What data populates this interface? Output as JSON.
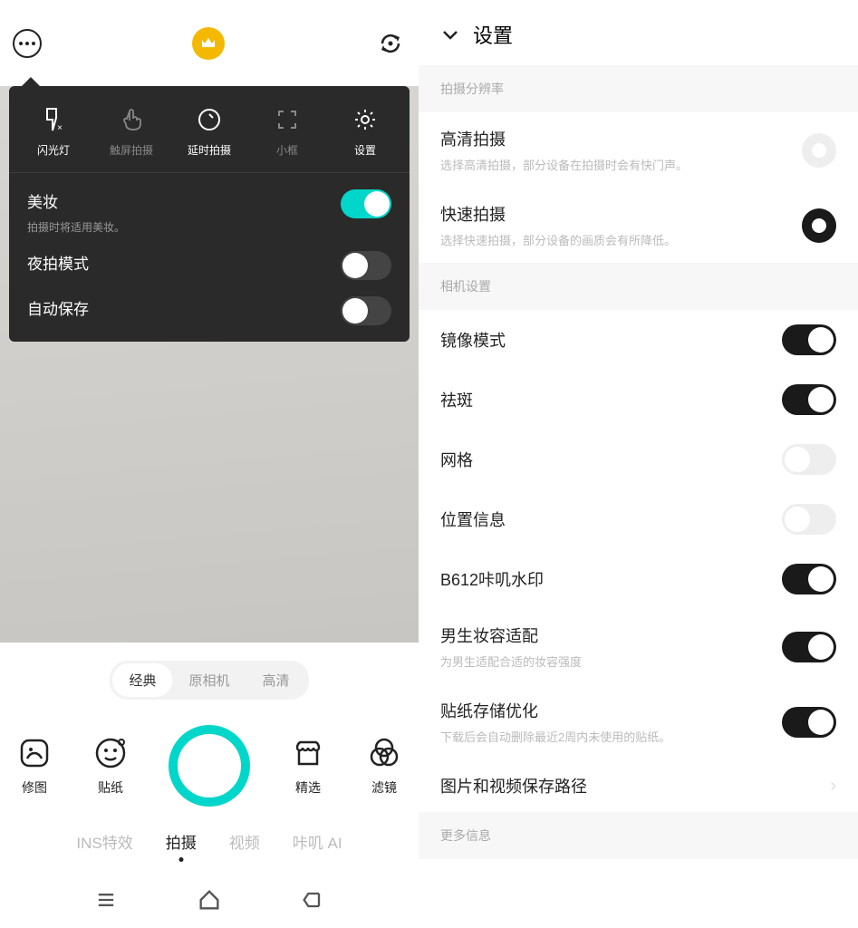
{
  "left": {
    "panel": {
      "items": [
        {
          "label": "闪光灯"
        },
        {
          "label": "触屏拍摄"
        },
        {
          "label": "延时拍摄"
        },
        {
          "label": "小框"
        },
        {
          "label": "设置"
        }
      ],
      "toggles": [
        {
          "title": "美妆",
          "sub": "拍摄时将适用美妆。",
          "on": true
        },
        {
          "title": "夜拍模式",
          "sub": "",
          "on": false
        },
        {
          "title": "自动保存",
          "sub": "",
          "on": false
        }
      ]
    },
    "pills": [
      "经典",
      "原相机",
      "高清"
    ],
    "actions": [
      {
        "label": "修图"
      },
      {
        "label": "贴纸"
      },
      {
        "label": "精选"
      },
      {
        "label": "滤镜"
      }
    ],
    "modes": [
      "INS特效",
      "拍摄",
      "视频",
      "咔叽 AI"
    ]
  },
  "right": {
    "header": "设置",
    "sections": [
      {
        "title": "拍摄分辨率",
        "rows": [
          {
            "title": "高清拍摄",
            "sub": "选择高清拍摄，部分设备在拍摄时会有快门声。",
            "type": "radio",
            "on": false
          },
          {
            "title": "快速拍摄",
            "sub": "选择快速拍摄，部分设备的画质会有所降低。",
            "type": "radio",
            "on": true
          }
        ]
      },
      {
        "title": "相机设置",
        "rows": [
          {
            "title": "镜像模式",
            "sub": "",
            "type": "toggle",
            "on": true
          },
          {
            "title": "祛斑",
            "sub": "",
            "type": "toggle",
            "on": true
          },
          {
            "title": "网格",
            "sub": "",
            "type": "toggle",
            "on": false
          },
          {
            "title": "位置信息",
            "sub": "",
            "type": "toggle",
            "on": false
          },
          {
            "title": "B612咔叽水印",
            "sub": "",
            "type": "toggle",
            "on": true
          },
          {
            "title": "男生妆容适配",
            "sub": "为男生适配合适的妆容强度",
            "type": "toggle",
            "on": true
          },
          {
            "title": "贴纸存储优化",
            "sub": "下载后会自动删除最近2周内未使用的贴纸。",
            "type": "toggle",
            "on": true
          },
          {
            "title": "图片和视频保存路径",
            "sub": "",
            "type": "link"
          }
        ]
      },
      {
        "title": "更多信息",
        "rows": []
      }
    ]
  }
}
